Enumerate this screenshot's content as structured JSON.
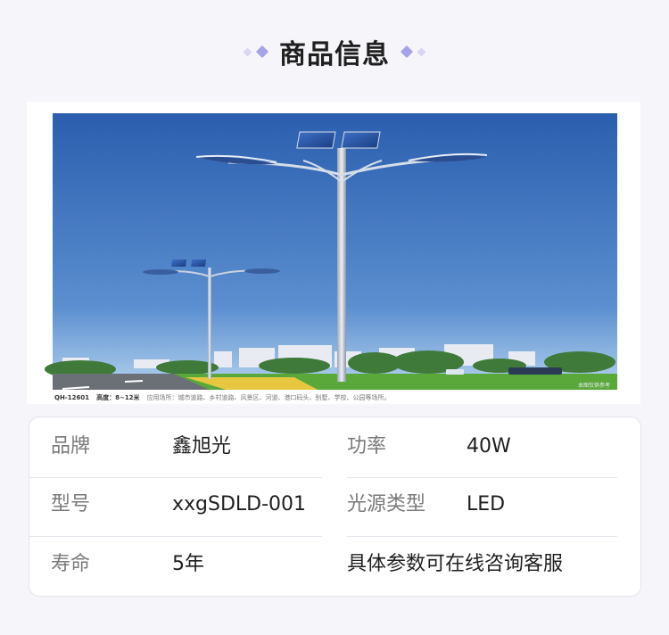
{
  "header": {
    "title": "商品信息",
    "deco_colors": {
      "outer": "#d8d6f2",
      "inner": "#a7a3e6"
    }
  },
  "product_image": {
    "caption_code": "QH-12601",
    "caption_height": "高度：8~12米",
    "caption_usage": "应用场所：城市道路、乡村道路、风景区、河道、港口码头、别墅、学校、公园等场所。",
    "caption_right": "本图仅供参考"
  },
  "specs": [
    {
      "label": "品牌",
      "value": "鑫旭光"
    },
    {
      "label": "功率",
      "value": "40W"
    },
    {
      "label": "型号",
      "value": "xxgSDLD-001"
    },
    {
      "label": "光源类型",
      "value": "LED"
    },
    {
      "label": "寿命",
      "value": "5年"
    },
    {
      "label": "",
      "value": "具体参数可在线咨询客服"
    }
  ],
  "colors": {
    "sky_top": "#2a5fb0",
    "sky_bottom": "#a8c9ea",
    "grass": "#5aa83a",
    "flowers": "#e7c640"
  }
}
